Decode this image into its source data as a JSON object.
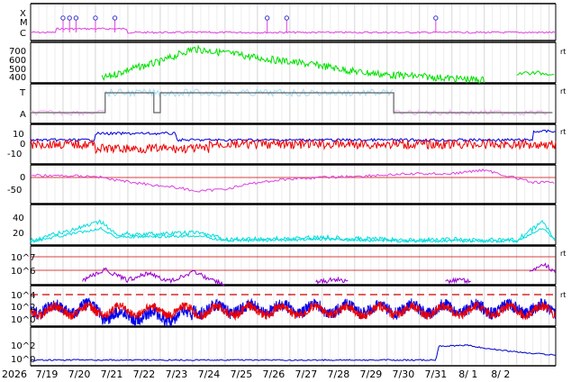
{
  "chart_data": {
    "type": "line",
    "year_label": "2026",
    "x_ticks": [
      "7/19",
      "7/20",
      "7/21",
      "7/22",
      "7/23",
      "7/24",
      "7/25",
      "7/26",
      "7/27",
      "7/28",
      "7/29",
      "7/30",
      "7/31",
      "8/ 1",
      "8/ 2"
    ],
    "right_marker": "rt",
    "panels": [
      {
        "id": "xray",
        "y_tick_labels": [
          "X",
          "M",
          "C"
        ],
        "colors": {
          "line": "#e040e0",
          "event": "#3333cc"
        },
        "event_days": [
          1.0,
          1.2,
          1.4,
          2.0,
          2.6,
          7.3,
          7.9,
          12.5
        ]
      },
      {
        "id": "speed",
        "y_tick_labels": [
          "700",
          "600",
          "500",
          "400"
        ],
        "ylim": [
          300,
          800
        ],
        "colors": {
          "line": "#00e000"
        },
        "points": [
          [
            2.2,
            350
          ],
          [
            3.0,
            460
          ],
          [
            4.0,
            560
          ],
          [
            5.0,
            720
          ],
          [
            6.0,
            670
          ],
          [
            7.0,
            610
          ],
          [
            8.0,
            560
          ],
          [
            9.0,
            510
          ],
          [
            10.0,
            440
          ],
          [
            11.0,
            400
          ],
          [
            12.0,
            380
          ],
          [
            13.0,
            355
          ],
          [
            14.0,
            335
          ],
          [
            15.0,
            420
          ]
        ]
      },
      {
        "id": "imf-sector",
        "y_tick_labels": [
          "T",
          "A"
        ],
        "colors": {
          "line": "#a0e0ff",
          "alt": "#ffb0ff",
          "state": "#606060"
        },
        "states": [
          [
            0,
            "A"
          ],
          [
            2.3,
            "T"
          ],
          [
            3.8,
            "A"
          ],
          [
            4.0,
            "T"
          ],
          [
            11.2,
            "A"
          ],
          [
            16.1,
            "T"
          ]
        ]
      },
      {
        "id": "bfield",
        "y_tick_labels": [
          "10",
          "0",
          "-10"
        ],
        "ylim": [
          -15,
          15
        ],
        "colors": {
          "bt": "#0000dd",
          "bz": "#ee0000"
        }
      },
      {
        "id": "angle",
        "y_tick_labels": [
          "0",
          "-50"
        ],
        "ylim": [
          -90,
          40
        ],
        "colors": {
          "line": "#e040e0",
          "ref": "#cc0000"
        },
        "points": [
          [
            0,
            8
          ],
          [
            2.0,
            5
          ],
          [
            2.5,
            -8
          ],
          [
            3.5,
            -25
          ],
          [
            4.5,
            -40
          ],
          [
            5.2,
            -55
          ],
          [
            6.0,
            -45
          ],
          [
            7.0,
            -20
          ],
          [
            8.0,
            -5
          ],
          [
            9.0,
            0
          ],
          [
            10.0,
            5
          ],
          [
            11.0,
            10
          ],
          [
            12.0,
            15
          ],
          [
            13.0,
            15
          ],
          [
            14.0,
            30
          ],
          [
            15.5,
            -20
          ]
        ]
      },
      {
        "id": "density",
        "y_tick_labels": [
          "40",
          "20"
        ],
        "ylim": [
          0,
          50
        ],
        "colors": {
          "line": "#00dddd"
        },
        "points": [
          [
            0,
            3
          ],
          [
            2.2,
            28
          ],
          [
            2.6,
            12
          ],
          [
            4.0,
            12
          ],
          [
            5.2,
            14
          ],
          [
            6.0,
            5
          ],
          [
            8.0,
            6
          ],
          [
            9.0,
            8
          ],
          [
            10.0,
            6
          ],
          [
            11.0,
            5
          ],
          [
            12.0,
            4
          ],
          [
            13.0,
            5
          ],
          [
            14.0,
            4
          ],
          [
            15.0,
            4
          ],
          [
            15.8,
            28
          ],
          [
            16.2,
            4
          ]
        ]
      },
      {
        "id": "electron",
        "y_tick_labels": [
          "10^7",
          "10^6"
        ],
        "colors": {
          "line": "#9900cc",
          "ref": "#cc0000"
        },
        "peaks": [
          [
            2.3,
            0.65
          ],
          [
            3.6,
            0.5
          ],
          [
            5.0,
            0.55
          ],
          [
            9.4,
            0.2
          ],
          [
            13.2,
            0.2
          ],
          [
            15.8,
            0.95
          ]
        ]
      },
      {
        "id": "proton",
        "y_tick_labels": [
          "10^4",
          "10^2",
          "10^0"
        ],
        "colors": {
          "a": "#0000ee",
          "b": "#ee0000",
          "threshold": "#cc0000"
        }
      },
      {
        "id": "highenergy",
        "y_tick_labels": [
          "10^2",
          "10^0"
        ],
        "colors": {
          "line": "#0000cc"
        },
        "points": [
          [
            0,
            0.2
          ],
          [
            12.5,
            0.2
          ],
          [
            12.6,
            0.9
          ],
          [
            13.5,
            0.95
          ],
          [
            14.0,
            0.8
          ],
          [
            15.0,
            0.6
          ],
          [
            16.2,
            0.45
          ]
        ]
      }
    ]
  }
}
